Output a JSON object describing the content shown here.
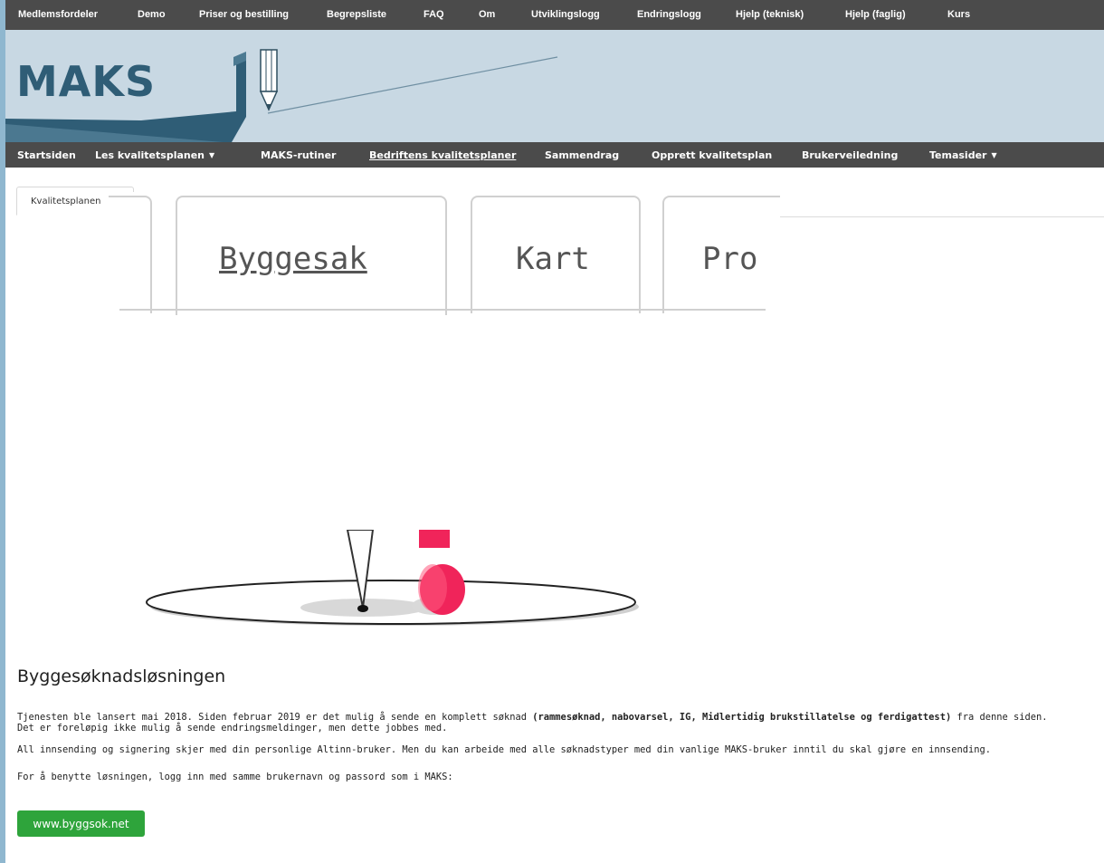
{
  "top_nav": [
    "Medlemsfordeler",
    "Demo",
    "Priser og bestilling",
    "Begrepsliste",
    "FAQ",
    "Om",
    "Utviklingslogg",
    "Endringslogg",
    "Hjelp (teknisk)",
    "Hjelp (faglig)",
    "Kurs"
  ],
  "logo": {
    "text": "MAKS"
  },
  "main_nav": [
    {
      "label": "Startsiden"
    },
    {
      "label": "Les kvalitetsplanen",
      "dropdown": true
    },
    {
      "label": "MAKS-rutiner"
    },
    {
      "label": "Bedriftens kvalitetsplaner",
      "active": true
    },
    {
      "label": "Sammendrag"
    },
    {
      "label": "Opprett kvalitetsplan"
    },
    {
      "label": "Brukerveiledning"
    },
    {
      "label": "Temasider",
      "dropdown": true
    }
  ],
  "content_tab": {
    "label": "Kvalitetsplanen"
  },
  "hero_tabs": [
    "Byggesak",
    "Kart",
    "Pro"
  ],
  "article": {
    "title": "Byggesøknadsløsningen",
    "p1_a": "Tjenesten ble lansert mai 2018. Siden februar 2019 er det mulig å sende en komplett søknad ",
    "p1_bold": "(rammesøknad, nabovarsel, IG, Midlertidig brukstillatelse og ferdigattest)",
    "p1_b": " fra denne siden.",
    "p1_line2": "Det er foreløpig ikke mulig å sende endringsmeldinger, men dette jobbes med.",
    "p2": "All innsending og signering skjer med din personlige Altinn-bruker. Men du kan arbeide med alle søknadstyper med din vanlige MAKS-bruker inntil du skal gjøre en innsending.",
    "p3": "For å benytte løsningen, logg inn med samme brukernavn og passord som i MAKS:",
    "cta_label": "www.byggsok.net"
  },
  "colors": {
    "nav_bg": "#4b4b4b",
    "banner_bg": "#c8d8e3",
    "logo": "#2f5d76",
    "cta": "#2ea43b",
    "accent_pink": "#f0245a"
  }
}
